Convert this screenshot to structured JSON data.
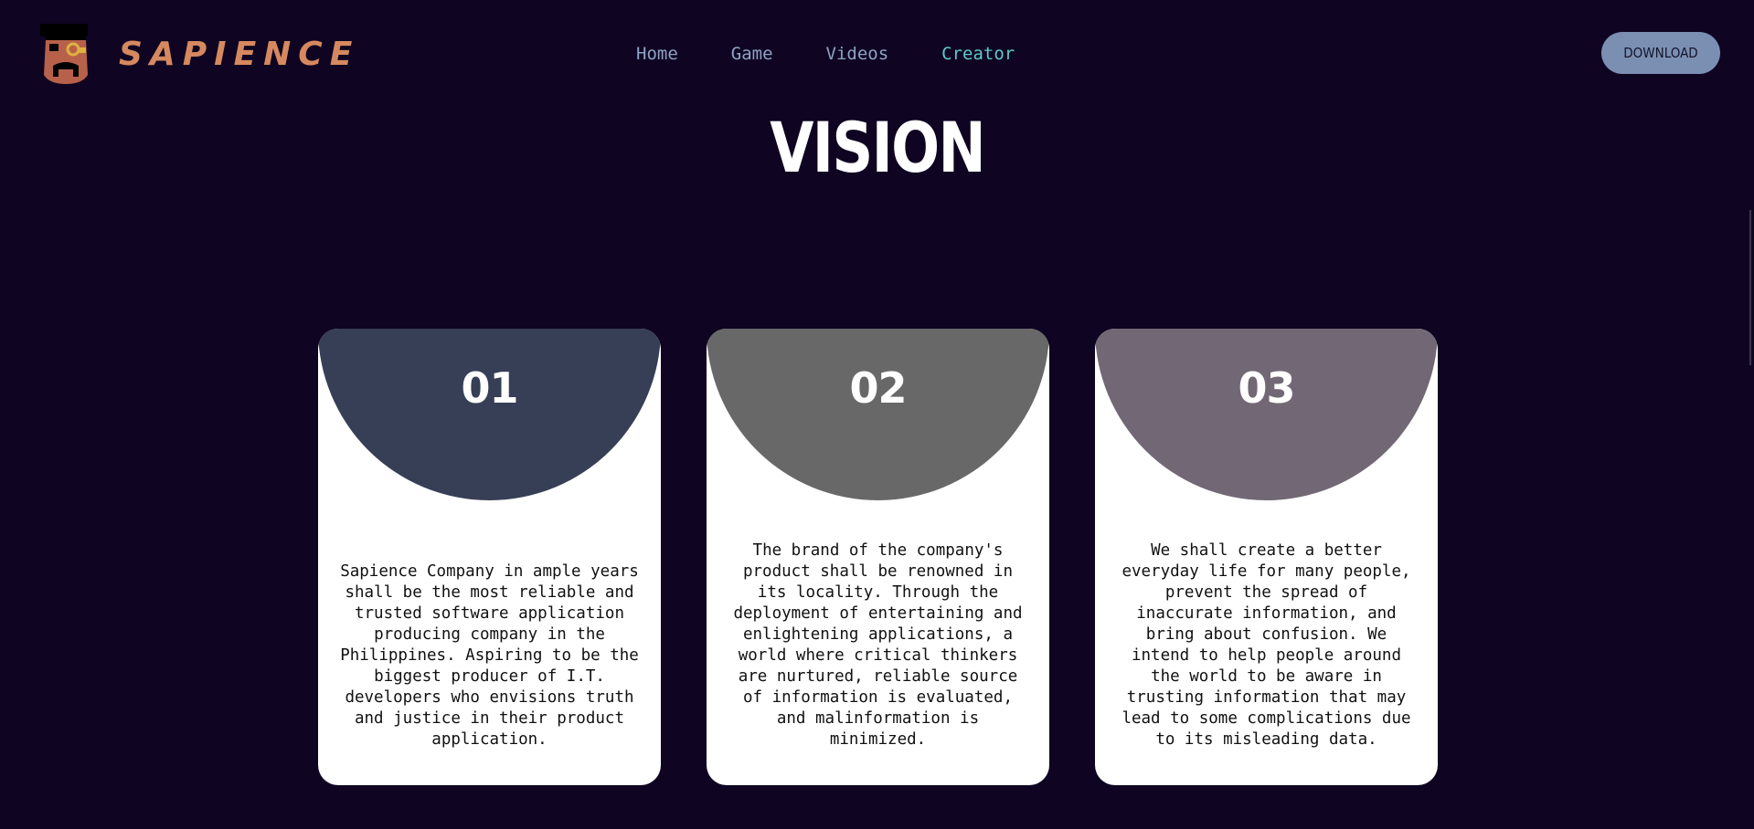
{
  "brand": {
    "name": "SAPIENCE",
    "color": "#d6895f"
  },
  "nav": {
    "items": [
      "Home",
      "Game",
      "Videos",
      "Creator"
    ],
    "active": "Creator"
  },
  "header": {
    "download_label": "DOWNLOAD"
  },
  "section": {
    "title": "VISION"
  },
  "cards": [
    {
      "number": "01",
      "color": "#363f55",
      "text": "Sapience Company in ample years shall be the most reliable and trusted software application producing company in the Philippines. Aspiring to be the biggest producer of I.T. developers who envisions truth and justice in their product application."
    },
    {
      "number": "02",
      "color": "#686868",
      "text": "The brand of the company's product shall be renowned in its locality. Through the deployment of entertaining and enlightening applications, a world where critical thinkers are nurtured, reliable source of information is evaluated, and malinformation is minimized."
    },
    {
      "number": "03",
      "color": "#726875",
      "text": "We shall create a better everyday life for many people, prevent the spread of inaccurate information, and bring about confusion. We intend to help people around the world to be aware in trusting information that may lead to some complications due to its misleading data."
    }
  ]
}
